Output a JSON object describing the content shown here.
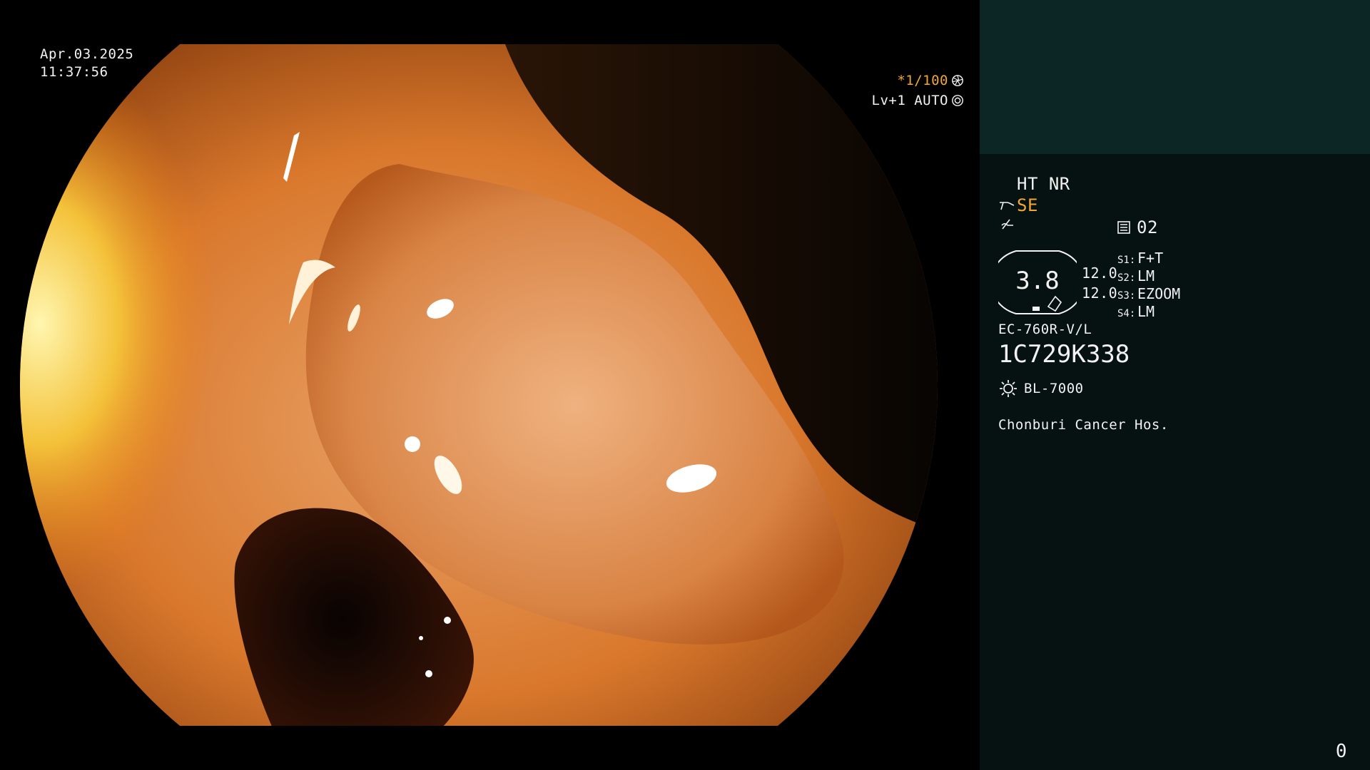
{
  "overlay": {
    "date": "Apr.03.2025",
    "time": "11:37:56",
    "shutter": "*1/100",
    "iris": "Lv+1 AUTO"
  },
  "panel": {
    "ht_nr": "HT NR",
    "se": "SE",
    "slot": "02",
    "dial_value": "3.8",
    "dial_params": [
      "12.0",
      "12.0"
    ],
    "settings": [
      {
        "key": "S1:",
        "value": "F+T"
      },
      {
        "key": "S2:",
        "value": "LM"
      },
      {
        "key": "S3:",
        "value": "EZOOM"
      },
      {
        "key": "S4:",
        "value": "LM"
      }
    ],
    "scope_model": "EC-760R-V/L",
    "serial": "1C729K338",
    "light_source": "BL-7000",
    "hospital": "Chonburi Cancer Hos.",
    "counter": "0"
  },
  "icons": {
    "shutter": "aperture-icon",
    "iris": "auto-iris-icon",
    "se": "scope-tip-icon",
    "enhancement": "enhancement-icon",
    "slot": "memory-slot-icon",
    "light": "light-source-icon"
  },
  "colors": {
    "accent_orange": "#f2a730",
    "panel_bg": "#061211",
    "panel_top": "#0b2624"
  }
}
